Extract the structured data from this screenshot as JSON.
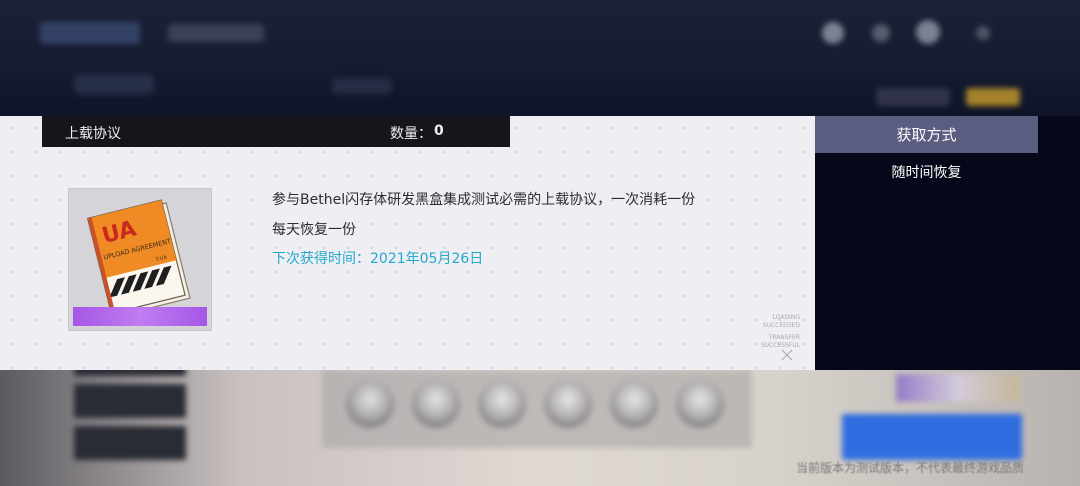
{
  "dialog": {
    "title": "上载协议",
    "quantity_label": "数量：",
    "quantity_value": "0",
    "item": {
      "name": "UPLOAD AGREEMENT",
      "logo_text": "UA",
      "subtext": "T-UA",
      "rarity_color": "#a557e6"
    },
    "description_line1": "参与Bethel闪存体研发黑盒集成测试必需的上载协议，一次消耗一份",
    "description_line2": "每天恢复一份",
    "next_time": "下次获得时间：2021年05月26日",
    "stamp": {
      "line1": "TRANSFER",
      "line2": "SUCCESSFUL",
      "line3": "LOADING SUCCEEDED"
    }
  },
  "acquisition": {
    "header": "获取方式",
    "method": "随时间恢复"
  },
  "background": {
    "note": "当前版本为测试版本，不代表最终游戏品质"
  },
  "colors": {
    "panel_bg": "#eeeef3",
    "title_bar": "#15161b",
    "side_bg": "#06081a",
    "side_header": "#5a5c80",
    "next_time": "#21a9cf",
    "start_button": "#2f6de0"
  }
}
